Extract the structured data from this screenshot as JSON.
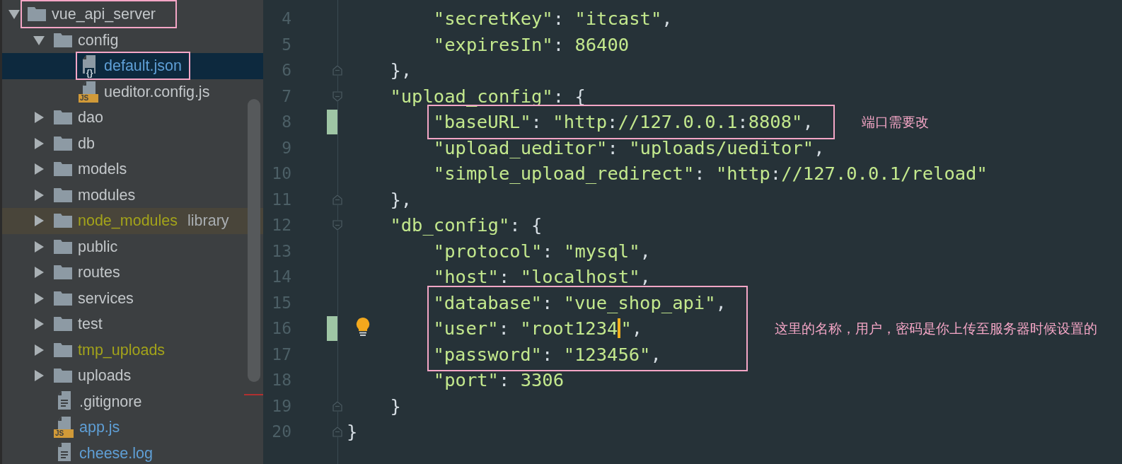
{
  "project_tree": {
    "items": [
      {
        "label": "vue_api_server",
        "kind": "folder",
        "expanded": true,
        "boxed": true,
        "selected": false,
        "children": [
          {
            "label": "config",
            "kind": "folder",
            "expanded": true,
            "boxed": false,
            "selected": false,
            "children": [
              {
                "label": "default.json",
                "kind": "json",
                "icon_text": "{}",
                "boxed": true,
                "selected": true,
                "color": "#5f9fd6"
              },
              {
                "label": "ueditor.config.js",
                "kind": "js",
                "icon_text": "JS",
                "boxed": false,
                "selected": false
              }
            ]
          },
          {
            "label": "dao",
            "kind": "folder",
            "expanded": false,
            "boxed": false,
            "selected": false
          },
          {
            "label": "db",
            "kind": "folder",
            "expanded": false,
            "boxed": false,
            "selected": false
          },
          {
            "label": "models",
            "kind": "folder",
            "expanded": false,
            "boxed": false,
            "selected": false
          },
          {
            "label": "modules",
            "kind": "folder",
            "expanded": false,
            "boxed": false,
            "selected": false
          },
          {
            "label": "node_modules",
            "tag": "library",
            "kind": "folder",
            "expanded": false,
            "boxed": false,
            "selected": false,
            "excluded": true,
            "color": "#a3a31a"
          },
          {
            "label": "public",
            "kind": "folder",
            "expanded": false,
            "boxed": false,
            "selected": false
          },
          {
            "label": "routes",
            "kind": "folder",
            "expanded": false,
            "boxed": false,
            "selected": false
          },
          {
            "label": "services",
            "kind": "folder",
            "expanded": false,
            "boxed": false,
            "selected": false
          },
          {
            "label": "test",
            "kind": "folder",
            "expanded": false,
            "boxed": false,
            "selected": false
          },
          {
            "label": "tmp_uploads",
            "kind": "folder",
            "expanded": false,
            "boxed": false,
            "selected": false,
            "color": "#a3a31a"
          },
          {
            "label": "uploads",
            "kind": "folder",
            "expanded": false,
            "boxed": false,
            "selected": false
          },
          {
            "label": ".gitignore",
            "kind": "text",
            "boxed": false,
            "selected": false
          },
          {
            "label": "app.js",
            "kind": "js",
            "icon_text": "JS",
            "boxed": false,
            "selected": false,
            "color": "#5f9fd6"
          },
          {
            "label": "cheese.log",
            "kind": "text",
            "boxed": false,
            "selected": false,
            "color": "#5f9fd6"
          }
        ]
      }
    ]
  },
  "editor": {
    "segments": [
      {
        "boxed": false,
        "lines": [
          {
            "number": "4",
            "text": "        \"secretKey\": \"itcast\",",
            "fold_start": false,
            "fold_end": false
          },
          {
            "number": "5",
            "text": "        \"expiresIn\": 86400",
            "fold_start": false,
            "fold_end": false
          },
          {
            "number": "6",
            "text": "    },",
            "fold_start": false,
            "fold_end": true
          },
          {
            "number": "7",
            "text": "    \"upload_config\": {",
            "fold_start": true,
            "fold_end": false
          }
        ]
      },
      {
        "boxed": true,
        "note": "端口需要改",
        "lines": [
          {
            "number": "8",
            "text": "        \"baseURL\": \"http://127.0.0.1:8808\",",
            "changed": true,
            "fold_start": false,
            "fold_end": false
          }
        ]
      },
      {
        "boxed": false,
        "lines": [
          {
            "number": "9",
            "text": "        \"upload_ueditor\": \"uploads/ueditor\",",
            "fold_start": false,
            "fold_end": false
          },
          {
            "number": "10",
            "text": "        \"simple_upload_redirect\": \"http://127.0.0.1/reload\"",
            "fold_start": false,
            "fold_end": false
          },
          {
            "number": "11",
            "text": "    },",
            "fold_start": false,
            "fold_end": true
          },
          {
            "number": "12",
            "text": "    \"db_config\": {",
            "fold_start": true,
            "fold_end": false
          },
          {
            "number": "13",
            "text": "        \"protocol\": \"mysql\",",
            "fold_start": false,
            "fold_end": false
          },
          {
            "number": "14",
            "text": "        \"host\": \"localhost\",",
            "fold_start": false,
            "fold_end": false
          }
        ]
      },
      {
        "boxed": true,
        "note": "这里的名称，用户，密码是你上传至服务器时候设置的",
        "lines": [
          {
            "number": "15",
            "text": "        \"database\": \"vue_shop_api\",",
            "fold_start": false,
            "fold_end": false
          },
          {
            "number": "16",
            "text": "        \"user\": \"root1234",
            "after_caret": "\",",
            "changed": true,
            "bulb": true,
            "fold_start": false,
            "fold_end": false
          },
          {
            "number": "17",
            "text": "        \"password\": \"123456\",",
            "fold_start": false,
            "fold_end": false
          }
        ]
      },
      {
        "boxed": false,
        "lines": [
          {
            "number": "18",
            "text": "        \"port\": 3306",
            "fold_start": false,
            "fold_end": false
          },
          {
            "number": "19",
            "text": "    }",
            "fold_start": false,
            "fold_end": true
          },
          {
            "number": "20",
            "text": "}",
            "fold_start": false,
            "fold_end": true
          }
        ]
      }
    ]
  }
}
